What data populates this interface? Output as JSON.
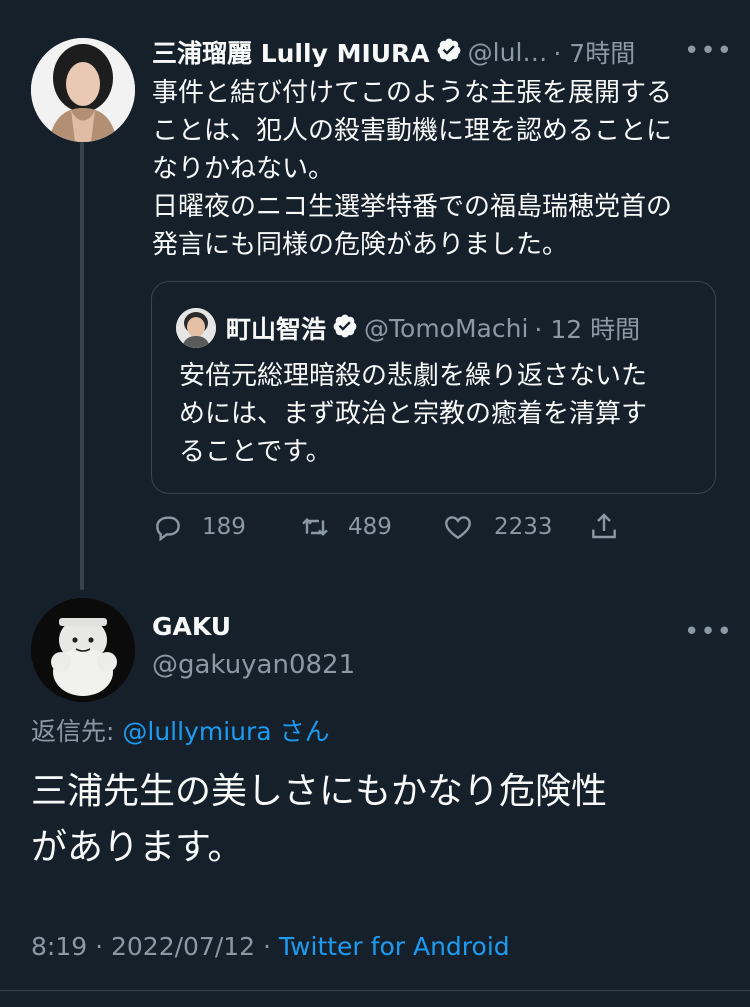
{
  "tweet1": {
    "author_name": "三浦瑠麗 Lully MIURA",
    "handle": "@lul…",
    "time": "· 7時間",
    "more": "•••",
    "text": "事件と結び付けてこのような主張を展開する\nことは、犯人の殺害動機に理を認めることに\nなりかねない。\n日曜夜のニコ生選挙特番での福島瑞穂党首の\n発言にも同様の危険がありました。",
    "quote": {
      "author_name": "町山智浩",
      "handle": "@TomoMachi",
      "time": "· 12 時間",
      "text": "安倍元総理暗殺の悲劇を繰り返さないた\nめには、まず政治と宗教の癒着を清算す\nることです。"
    },
    "actions": {
      "replies": "189",
      "retweets": "489",
      "likes": "2233"
    }
  },
  "tweet2": {
    "author_name": "GAKU",
    "handle": "@gakuyan0821",
    "more": "•••",
    "reply_prefix": "返信先:",
    "reply_handle": "@lullymiura",
    "reply_suffix": "さん",
    "text": "三浦先生の美しさにもかなり危険性\nがあります。",
    "timestamp": "8:19 · 2022/07/12 ·",
    "source": "Twitter for Android"
  },
  "colors": {
    "background": "#15202b",
    "text": "#f7f9f9",
    "muted": "#8b98a5",
    "link": "#1d9bf0",
    "border": "#38444d"
  }
}
